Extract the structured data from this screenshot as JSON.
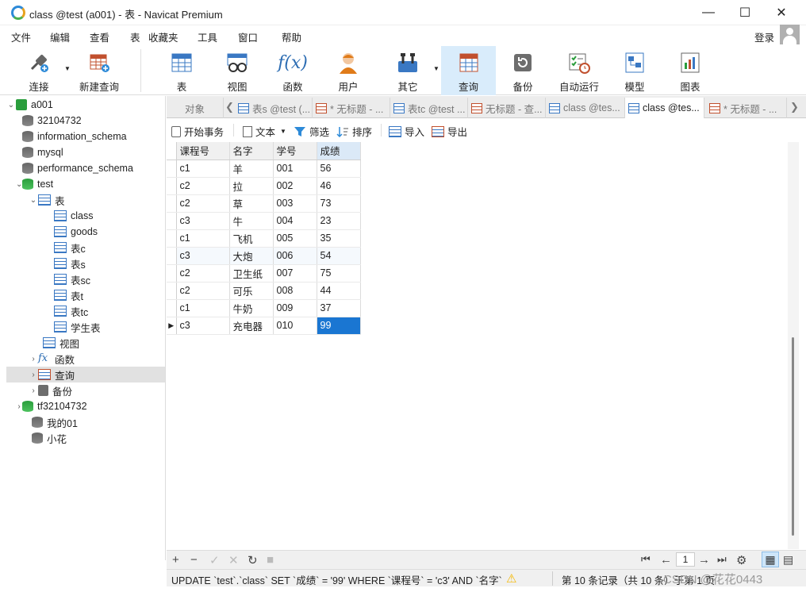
{
  "window": {
    "title": "class @test (a001) - 表 - Navicat Premium",
    "minimize": "—",
    "maximize": "☐",
    "close": "✕"
  },
  "menu": {
    "items": [
      "文件",
      "编辑",
      "查看",
      "表",
      "收藏夹",
      "工具",
      "窗口",
      "帮助"
    ],
    "login": "登录"
  },
  "toolbar": {
    "connect": "连接",
    "new_query": "新建查询",
    "table": "表",
    "view": "视图",
    "function": "函数",
    "user": "用户",
    "other": "其它",
    "query": "查询",
    "backup": "备份",
    "automation": "自动运行",
    "model": "模型",
    "chart": "图表"
  },
  "sidebar": {
    "nodes": [
      "a001",
      "32104732",
      "information_schema",
      "mysql",
      "performance_schema",
      "test",
      "表",
      "class",
      "goods",
      "表c",
      "表s",
      "表sc",
      "表t",
      "表tc",
      "学生表",
      "视图",
      "函数",
      "查询",
      "备份",
      "tf32104732",
      "我的01",
      "小花"
    ]
  },
  "tabs": {
    "objects": "对象",
    "items": [
      "表s @test (...",
      "* 无标题 - ...",
      "表tc @test ...",
      "无标题 - 查...",
      "class @tes...",
      "class @tes...",
      "* 无标题 - ..."
    ]
  },
  "datatoolbar": {
    "begin_txn": "开始事务",
    "text": "文本",
    "filter": "筛选",
    "sort": "排序",
    "import": "导入",
    "export": "导出"
  },
  "grid": {
    "columns": [
      "课程号",
      "名字",
      "学号",
      "成绩"
    ],
    "rows": [
      [
        "c1",
        "羊",
        "001",
        "56"
      ],
      [
        "c2",
        "拉",
        "002",
        "46"
      ],
      [
        "c2",
        "草",
        "003",
        "73"
      ],
      [
        "c3",
        "牛",
        "004",
        "23"
      ],
      [
        "c1",
        "飞机",
        "005",
        "35"
      ],
      [
        "c3",
        "大炮",
        "006",
        "54"
      ],
      [
        "c2",
        "卫生纸",
        "007",
        "75"
      ],
      [
        "c2",
        "可乐",
        "008",
        "44"
      ],
      [
        "c1",
        "牛奶",
        "009",
        "37"
      ],
      [
        "c3",
        "充电器",
        "010",
        "99"
      ]
    ]
  },
  "pager": {
    "page": "1"
  },
  "status": {
    "sql": "UPDATE `test`.`class` SET `成绩` = '99' WHERE `课程号` = 'c3' AND `名字`",
    "records": "第 10 条记录（共 10 条）于第 1 页",
    "watermark": "CSDN @花花0443"
  },
  "colors": {
    "accent": "#1a76d2",
    "selected_toolbar": "#d9ecfb",
    "warning": "#f5b800"
  }
}
